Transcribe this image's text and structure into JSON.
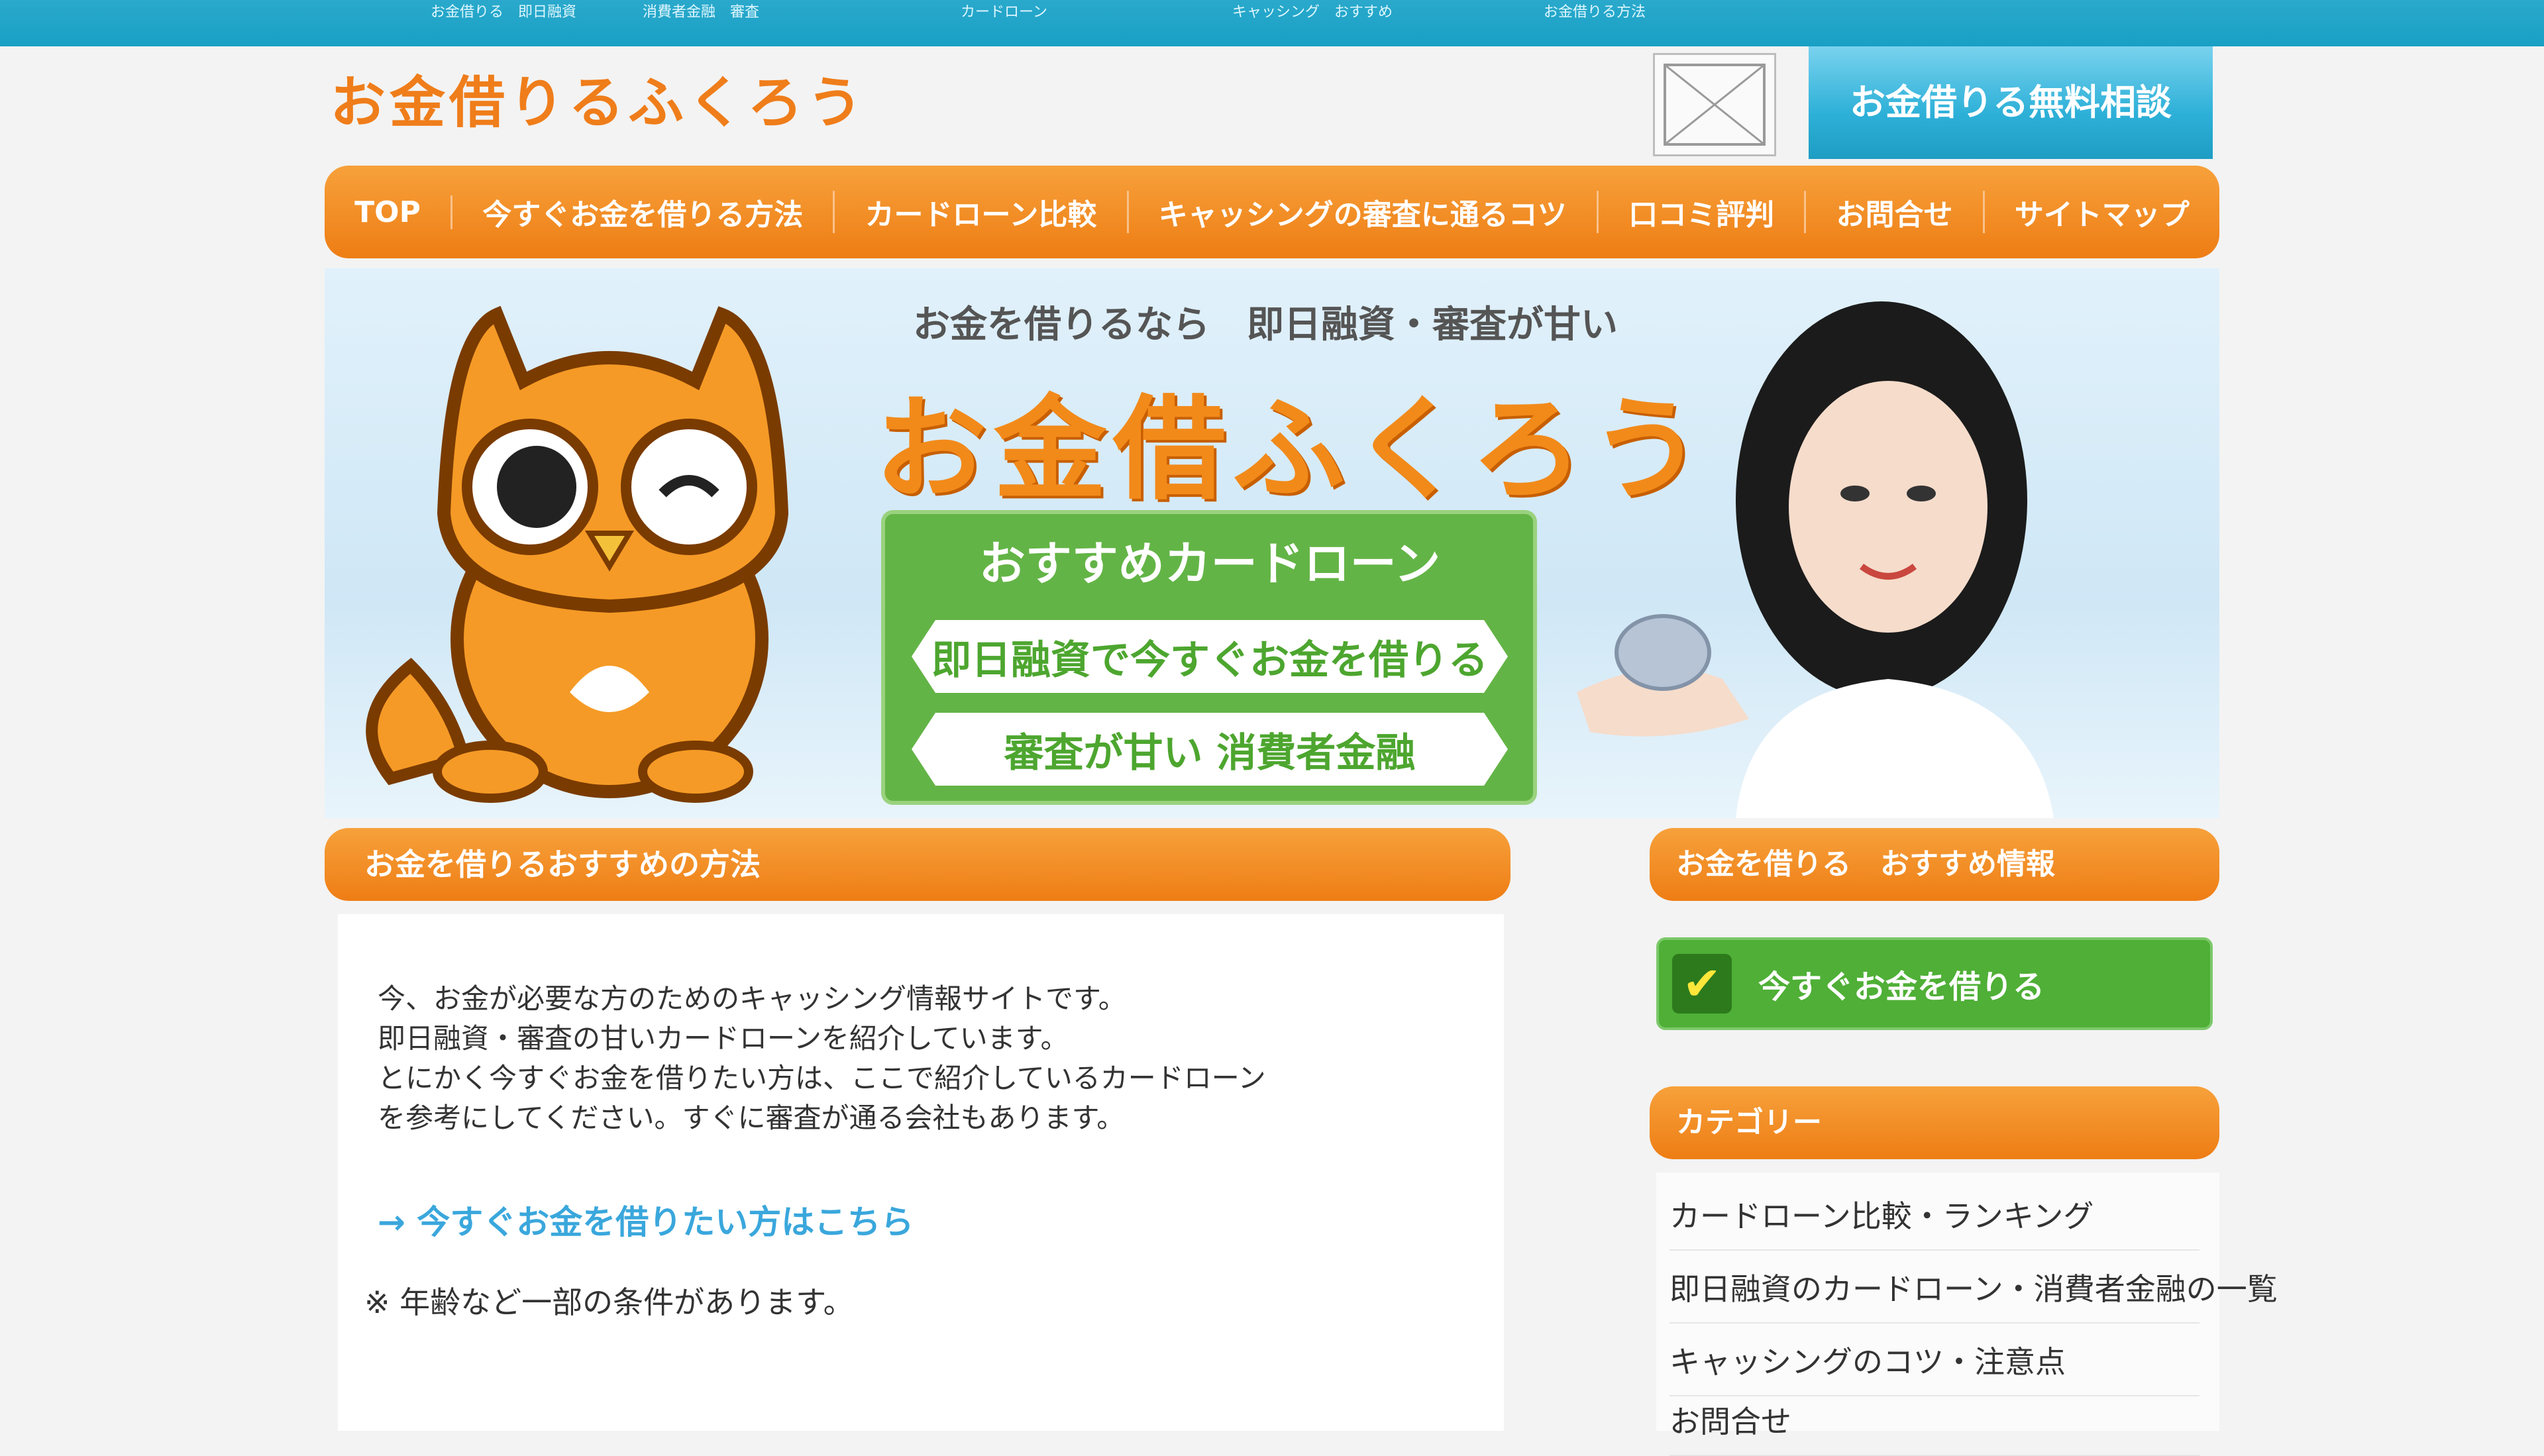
{
  "topbar": {
    "links": [
      "お金借りる　即日融資",
      "消費者金融　審査",
      "カードローン",
      "キャッシング　おすすめ",
      "お金借りる方法"
    ]
  },
  "header": {
    "logo": "お金借りるふくろう",
    "button_label": "お金借りる無料相談"
  },
  "nav": {
    "items": [
      "TOP",
      "今すぐお金を借りる方法",
      "カードローン比較",
      "キャッシングの審査に通るコツ",
      "口コミ評判",
      "お問合せ",
      "サイトマップ"
    ]
  },
  "hero": {
    "tagline": "お金を借りるなら　即日融資・審査が甘い",
    "title": "お金借ふくろう",
    "green_heading": "おすすめカードローン",
    "rows": [
      "即日融資で今すぐお金を借りる",
      "審査が甘い 消費者金融"
    ]
  },
  "main": {
    "bar_title": "お金を借りるおすすめの方法",
    "paragraphs": [
      "今、お金が必要な方のためのキャッシング情報サイトです。",
      "即日融資・審査の甘いカードローンを紹介しています。",
      "とにかく今すぐお金を借りたい方は、ここで紹介しているカードローン",
      "を参考にしてください。すぐに審査が通る会社もあります。"
    ],
    "link_text": "→ 今すぐお金を借りたい方はこちら",
    "note": "※ 年齢など一部の条件があります。"
  },
  "sidebar": {
    "bar1_title": "お金を借りる　おすすめ情報",
    "green_button": "今すぐお金を借りる",
    "bar2_title": "カテゴリー",
    "list": [
      "カードローン比較・ランキング",
      "即日融資のカードローン・消費者金融の一覧",
      "キャッシングのコツ・注意点",
      "お問合せ"
    ]
  },
  "colors": {
    "orange": "#ee7d14",
    "blue": "#1ea0c4",
    "green": "#4faf36"
  }
}
